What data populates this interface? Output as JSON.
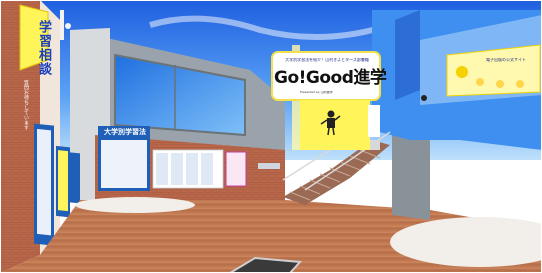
{
  "scene": {
    "main_sign": {
      "top_text": "大学別学習法を紹介！山村きよとターズ部書籍",
      "title": "Go!Good進学",
      "subtitle": "Presented by 山村進学"
    },
    "left_wall": {
      "vertical_title": "学習相談",
      "notes": "質問お待ちしています"
    },
    "board": {
      "title": "大学別学習法"
    },
    "right_sign": {
      "title": "電子出版の公式サイト"
    }
  },
  "colors": {
    "sky": "#2f7cf0",
    "sky_light": "#9ccaf8",
    "floor_wood": "#c47a52",
    "brick_wall": "#b9674a",
    "sign_yellow": "#fff45a",
    "sign_border": "#f7e34a",
    "banner_yellow": "#fff176",
    "blue_structure": "#3e8ff0",
    "board_blue": "#1f5fb8",
    "rug": "#f2eee9"
  },
  "icons": [
    "avatar-character-icon",
    "speaker-icon",
    "skybox",
    "floor-hatch"
  ]
}
